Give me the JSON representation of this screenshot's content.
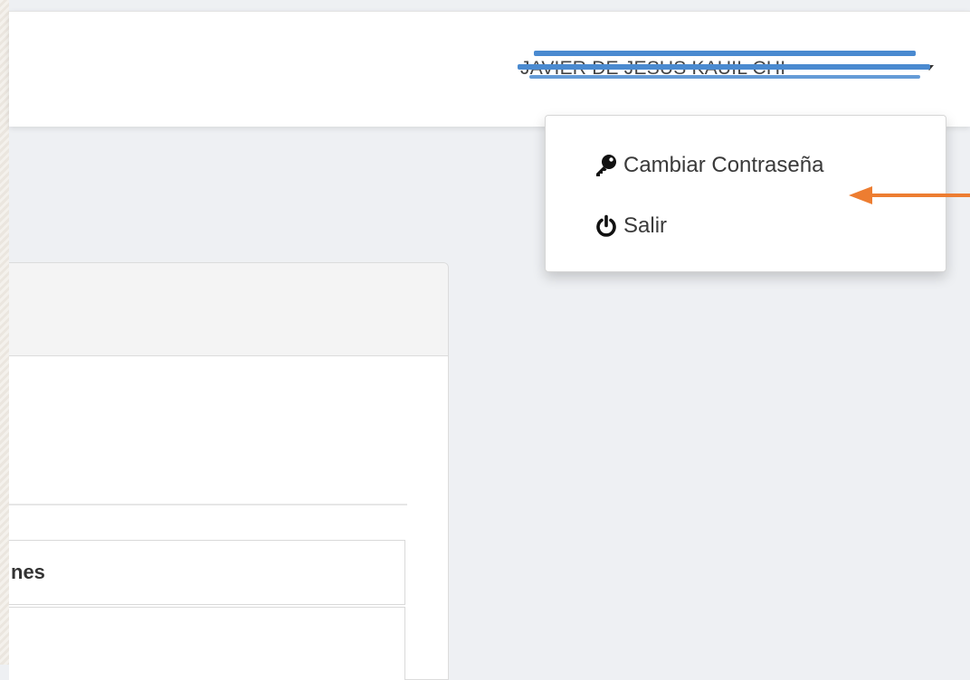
{
  "header": {
    "user_name": "JAVIER DE JESUS KAUIL CHI",
    "user_name_redacted": true
  },
  "user_menu": {
    "items": [
      {
        "label": "Cambiar Contraseña",
        "icon": "key-icon"
      },
      {
        "label": "Salir",
        "icon": "power-icon"
      }
    ]
  },
  "table": {
    "header_partial": "nes"
  },
  "colors": {
    "redaction": "#4a8ad0",
    "annotation_arrow": "#ed7d31",
    "background": "#eef0f3"
  }
}
